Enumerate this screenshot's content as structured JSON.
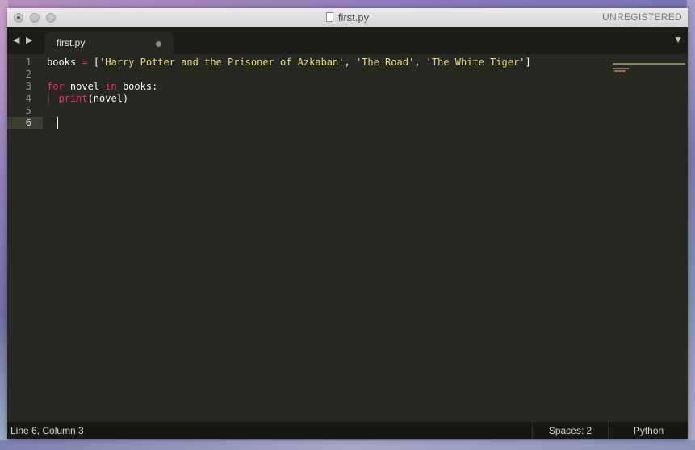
{
  "window": {
    "title": "first.py",
    "registration": "UNREGISTERED"
  },
  "tabs": [
    {
      "label": "first.py",
      "modified": true
    }
  ],
  "editor": {
    "line_numbers": [
      "1",
      "2",
      "3",
      "4",
      "5",
      "6"
    ],
    "current_line": 6,
    "lines": [
      [
        {
          "t": "books ",
          "c": "plain"
        },
        {
          "t": "=",
          "c": "kw"
        },
        {
          "t": " [",
          "c": "plain"
        },
        {
          "t": "'Harry Potter and the Prisoner of Azkaban'",
          "c": "str"
        },
        {
          "t": ", ",
          "c": "plain"
        },
        {
          "t": "'The Road'",
          "c": "str"
        },
        {
          "t": ", ",
          "c": "plain"
        },
        {
          "t": "'The White Tiger'",
          "c": "str"
        },
        {
          "t": "]",
          "c": "plain"
        }
      ],
      [],
      [
        {
          "t": "for",
          "c": "kw"
        },
        {
          "t": " novel ",
          "c": "plain"
        },
        {
          "t": "in",
          "c": "kw"
        },
        {
          "t": " books:",
          "c": "plain"
        }
      ],
      [
        {
          "t": "  ",
          "c": "plain"
        },
        {
          "t": "print",
          "c": "fn"
        },
        {
          "t": "(novel)",
          "c": "plain"
        }
      ],
      [],
      []
    ]
  },
  "status": {
    "position": "Line 6, Column 3",
    "spaces": "Spaces: 2",
    "syntax": "Python"
  },
  "colors": {
    "background": "#272822",
    "keyword": "#f92672",
    "string": "#e6db74",
    "text": "#f8f8f2",
    "line_number": "#8f908a"
  },
  "icons": {
    "close": "close-traffic-light",
    "minimize": "minimize-traffic-light",
    "zoom": "zoom-traffic-light",
    "file": "file-icon",
    "back": "nav-back-icon",
    "forward": "nav-forward-icon",
    "menu": "tab-menu-icon"
  }
}
